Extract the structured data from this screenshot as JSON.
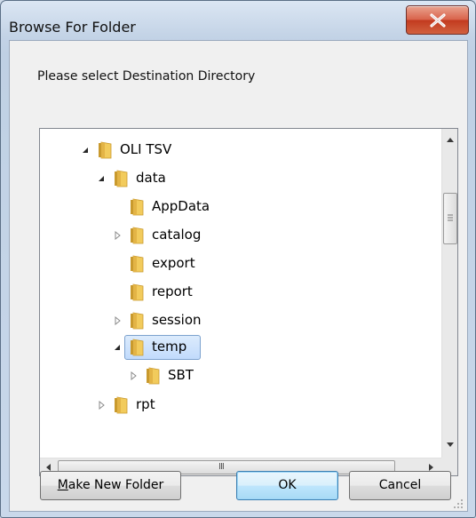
{
  "window": {
    "title": "Browse For Folder"
  },
  "dialog": {
    "prompt": "Please select Destination Directory"
  },
  "tree": {
    "nodes": [
      {
        "label": "OLI TSV",
        "state": "expanded"
      },
      {
        "label": "data",
        "state": "expanded"
      },
      {
        "label": "AppData",
        "state": "leaf"
      },
      {
        "label": "catalog",
        "state": "collapsed"
      },
      {
        "label": "export",
        "state": "leaf"
      },
      {
        "label": "report",
        "state": "leaf"
      },
      {
        "label": "session",
        "state": "collapsed"
      },
      {
        "label": "temp",
        "state": "expanded",
        "selected": true
      },
      {
        "label": "SBT",
        "state": "collapsed"
      },
      {
        "label": "rpt",
        "state": "collapsed"
      }
    ]
  },
  "buttons": {
    "make_new_folder": "Make New Folder",
    "ok": "OK",
    "cancel": "Cancel"
  },
  "scrollbar": {
    "horizontal_grip": "III"
  },
  "colors": {
    "folder_fill": "#f2cb5c",
    "selection_border": "#7da2ce",
    "close_button": "#c9432a"
  }
}
